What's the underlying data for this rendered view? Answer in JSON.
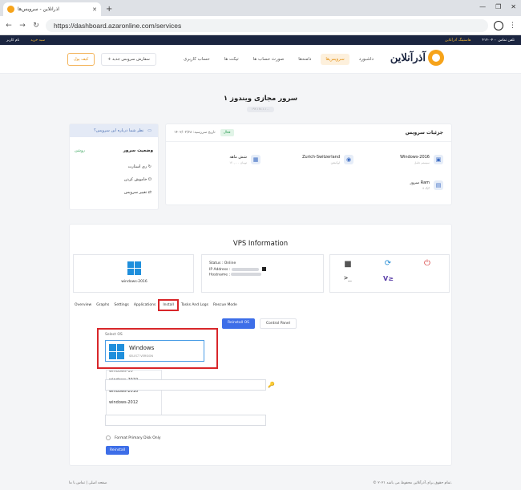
{
  "browser": {
    "tab_title": "آذرآنلاین - سرویس‌ها",
    "url": "https://dashboard.azaronline.com/services"
  },
  "topstrip": {
    "left_items": [
      "نام کاربر",
      "سبد خرید"
    ],
    "right_items": [
      "هاستینگ آذرآنلاین",
      "تلفن تماس ۴۰۰-۴۱۴۰"
    ]
  },
  "header": {
    "logo_text": "آذرآنلاین",
    "nav": [
      "داشبورد",
      "سرویس‌ها",
      "دامنه‌ها",
      "صورت حساب ها",
      "تیکت ها",
      "حساب کاربری"
    ],
    "active_nav_index": 1,
    "btn_new_service": "+ سفارش سرویس جدید",
    "btn_wallet": "کیف پول"
  },
  "page": {
    "title": "۱ سرور مجازی ویندوز",
    "subtitle": "۱۹۲.۱۶۸.۱.۱۰۰"
  },
  "sidebar": {
    "ask": "نظر شما درباره این سرویس؟",
    "status_label": "وضعیت سرور",
    "status_value": "روشن",
    "actions": [
      "ری استارت",
      "خاموش کردن",
      "تغییر سرویس"
    ]
  },
  "details": {
    "title": "جزئیات سرویس",
    "date_label": "تاریخ سررسید: ۱۴۰۲/۰۳/۲۸",
    "status_badge": "فعال",
    "items": [
      {
        "label": "Windows-2016",
        "sub": "سیستم عامل"
      },
      {
        "label": "Zurich-Switzerland",
        "sub": "لوکیشن"
      },
      {
        "label": "شش ماهه",
        "sub": "۱۲۰,۰۰۰ تومان"
      },
      {
        "label": "سرور Ram",
        "sub": "4 گیگ"
      }
    ]
  },
  "vps": {
    "title": "VPS Information",
    "os_label": "windows-2016",
    "status_line": "Status : Online",
    "ip_line": "IP Address :",
    "host_line": "Hostname :",
    "tabs": [
      "Overview",
      "Graphs",
      "Settings",
      "Applications",
      "Install",
      "Tasks And Logs",
      "Rescue Mode"
    ],
    "active_tab_index": 4,
    "btn_reinstall_os": "Reinstall OS",
    "btn_control_panel": "Control Panel",
    "select_os_label": "Select OS",
    "selected_os_name": "Windows",
    "selected_os_hint": "SELECT VERSION",
    "versions": [
      "windows-10",
      "windows-2019",
      "windows-2016",
      "windows-2012"
    ],
    "format_label": "Format Primary Disk Only",
    "btn_reinstall": "Reinstall"
  },
  "footer": {
    "left": "صفحه اصلی  |  تماس با ما",
    "right": "© ۲۰۲۱ تمام حقوق برای آذرآنلاین محفوظ می باشد."
  }
}
